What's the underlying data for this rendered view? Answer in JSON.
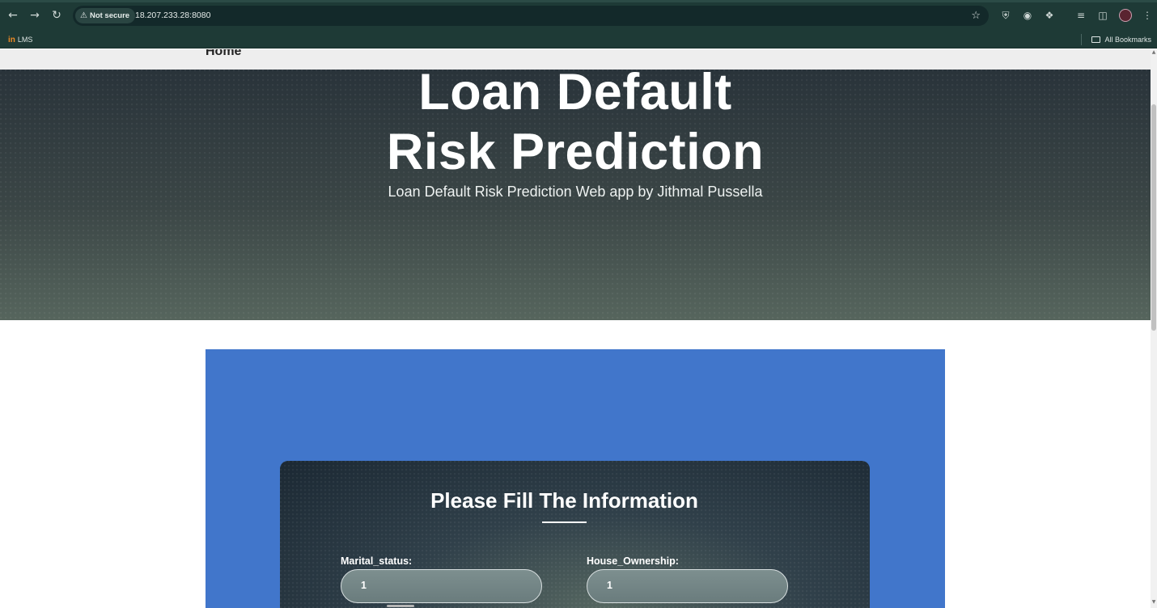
{
  "browser": {
    "security_label": "Not secure",
    "url": "18.207.233.28:8080",
    "bookmark_lms": "LMS",
    "bookmark_lms_logo": "in",
    "all_bookmarks": "All Bookmarks",
    "icons": {
      "back": "arrow-left-icon",
      "forward": "arrow-right-icon",
      "reload": "reload-icon",
      "warning": "warning-triangle-icon",
      "bookmark_star": "star-icon",
      "extensions": "puzzle-icon",
      "menu": "kebab-menu-icon"
    }
  },
  "page": {
    "nav_home": "Home",
    "hero_title_line1": "Loan Default",
    "hero_title_line2": "Risk Prediction",
    "hero_subtitle": "Loan Default Risk Prediction Web app by Jithmal Pussella",
    "form_title": "Please Fill The Information",
    "fields": [
      {
        "label": "Marital_status:",
        "value": "1"
      },
      {
        "label": "House_Ownership:",
        "value": "1"
      }
    ],
    "colors": {
      "panel_blue": "#4176cb",
      "hero_dark": "#3a4647",
      "chrome": "#1e3a36"
    }
  }
}
